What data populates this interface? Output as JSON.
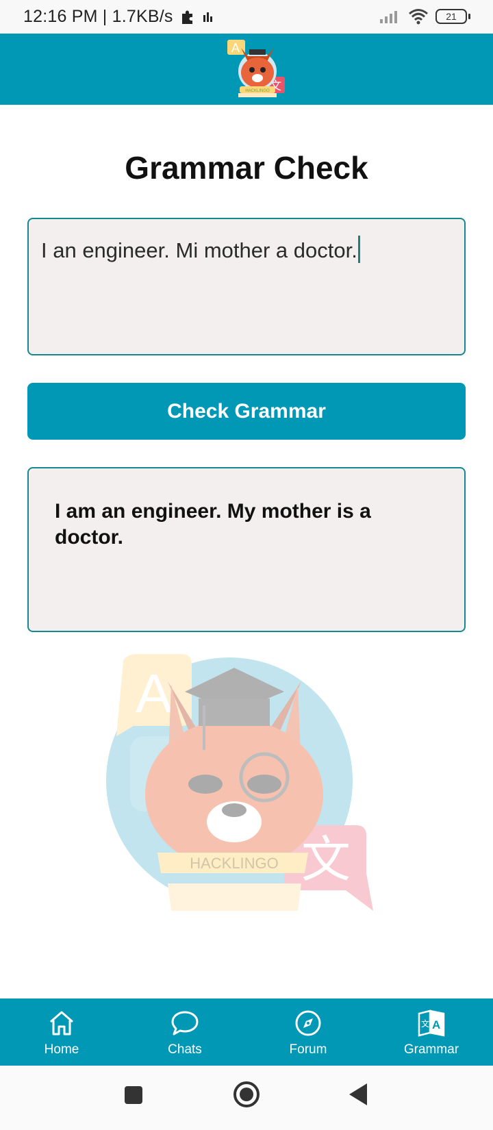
{
  "status_bar": {
    "time": "12:16 PM | 1.7KB/s",
    "battery": "21",
    "icons": [
      "puzzle-icon",
      "data-bars-icon",
      "signal-icon",
      "wifi-icon",
      "battery-icon"
    ]
  },
  "header": {
    "logo_text": "HACKLINGO"
  },
  "page": {
    "title": "Grammar Check"
  },
  "input": {
    "value": "I an engineer. Mi mother a doctor."
  },
  "check_button": {
    "label": "Check Grammar"
  },
  "result": {
    "text": "I am an engineer. My mother is a doctor."
  },
  "watermark": {
    "text": "HACKLINGO"
  },
  "bottom_nav": {
    "items": [
      {
        "label": "Home",
        "icon": "home-icon"
      },
      {
        "label": "Chats",
        "icon": "chat-bubble-icon"
      },
      {
        "label": "Forum",
        "icon": "compass-icon"
      },
      {
        "label": "Grammar",
        "icon": "translate-book-icon"
      }
    ]
  },
  "colors": {
    "primary": "#0098b5",
    "field_border": "#14878f",
    "field_background": "#f3efee"
  }
}
